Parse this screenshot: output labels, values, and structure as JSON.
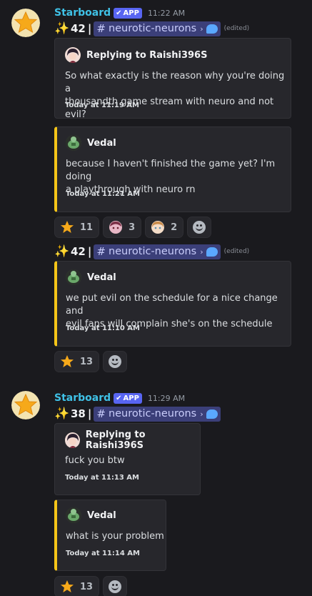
{
  "colors": {
    "background": "#1a1a1e",
    "username": "#3fc1e6",
    "app_badge": "#5865f2",
    "embed_accent": "#f5c518",
    "channel_mention_bg": "#3b3f79"
  },
  "messages": [
    {
      "username": "Starboard",
      "badge": "APP",
      "timestamp": "11:22 AM",
      "avatar_icon": "star-avatar-icon",
      "posts": [
        {
          "stars": "42",
          "channel": "neurotic-neurons",
          "edited": "(edited)",
          "embeds": [
            {
              "type": "reply",
              "author": "Replying to Raishi396S",
              "lines": [
                "So what exactly is the reason why you're doing a",
                "thousandth game stream with neuro and not evil?"
              ],
              "footer": "Today at 11:19 AM"
            },
            {
              "type": "highlight",
              "author": "Vedal",
              "lines": [
                "because I haven't finished the game yet? I'm doing",
                "a playthrough with neuro rn"
              ],
              "footer": "Today at 11:21 AM"
            }
          ],
          "reactions": [
            {
              "emoji": "star-emoji",
              "count": "11"
            },
            {
              "emoji": "evil-emote",
              "count": "3"
            },
            {
              "emoji": "neuro-emote",
              "count": "2"
            }
          ]
        },
        {
          "stars": "42",
          "channel": "neurotic-neurons",
          "edited": "(edited)",
          "embeds": [
            {
              "type": "highlight",
              "author": "Vedal",
              "lines": [
                "we put evil on the schedule for a nice change and",
                "evil fans will complain she's on the schedule"
              ],
              "footer": "Today at 11:10 AM"
            }
          ],
          "reactions": [
            {
              "emoji": "star-emoji",
              "count": "13"
            }
          ]
        }
      ]
    },
    {
      "username": "Starboard",
      "badge": "APP",
      "timestamp": "11:29 AM",
      "avatar_icon": "star-avatar-icon",
      "posts": [
        {
          "stars": "38",
          "channel": "neurotic-neurons",
          "edited": "",
          "embeds": [
            {
              "type": "reply",
              "author": "Replying to Raishi396S",
              "lines": [
                "fuck you btw"
              ],
              "footer": "Today at 11:13 AM"
            },
            {
              "type": "highlight",
              "author": "Vedal",
              "lines": [
                "what is your problem"
              ],
              "footer": "Today at 11:14 AM"
            }
          ],
          "reactions": [
            {
              "emoji": "star-emoji",
              "count": "13"
            }
          ]
        }
      ]
    }
  ]
}
